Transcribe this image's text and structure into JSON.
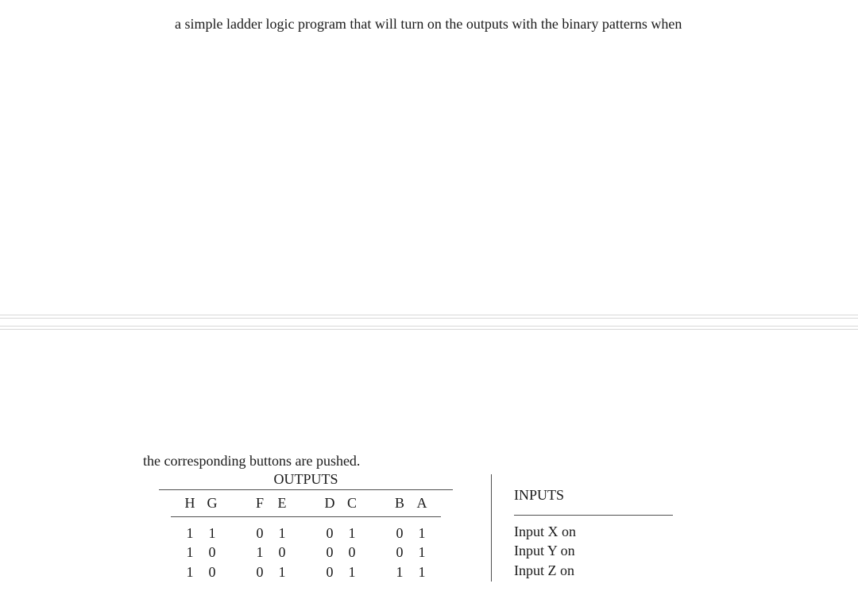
{
  "top_text": "a simple ladder logic program that will turn on the outputs with the binary patterns when",
  "continuation_text": "the corresponding buttons are pushed.",
  "outputs_title": "OUTPUTS",
  "inputs_title": "INPUTS",
  "chart_data": {
    "type": "table",
    "output_headers": [
      "H",
      "G",
      "F",
      "E",
      "D",
      "C",
      "B",
      "A"
    ],
    "output_rows": [
      [
        "1",
        "1",
        "0",
        "1",
        "0",
        "1",
        "0",
        "1"
      ],
      [
        "1",
        "0",
        "1",
        "0",
        "0",
        "0",
        "0",
        "1"
      ],
      [
        "1",
        "0",
        "0",
        "1",
        "0",
        "1",
        "1",
        "1"
      ]
    ],
    "input_labels": [
      "Input X on",
      "Input Y on",
      "Input Z on"
    ]
  }
}
